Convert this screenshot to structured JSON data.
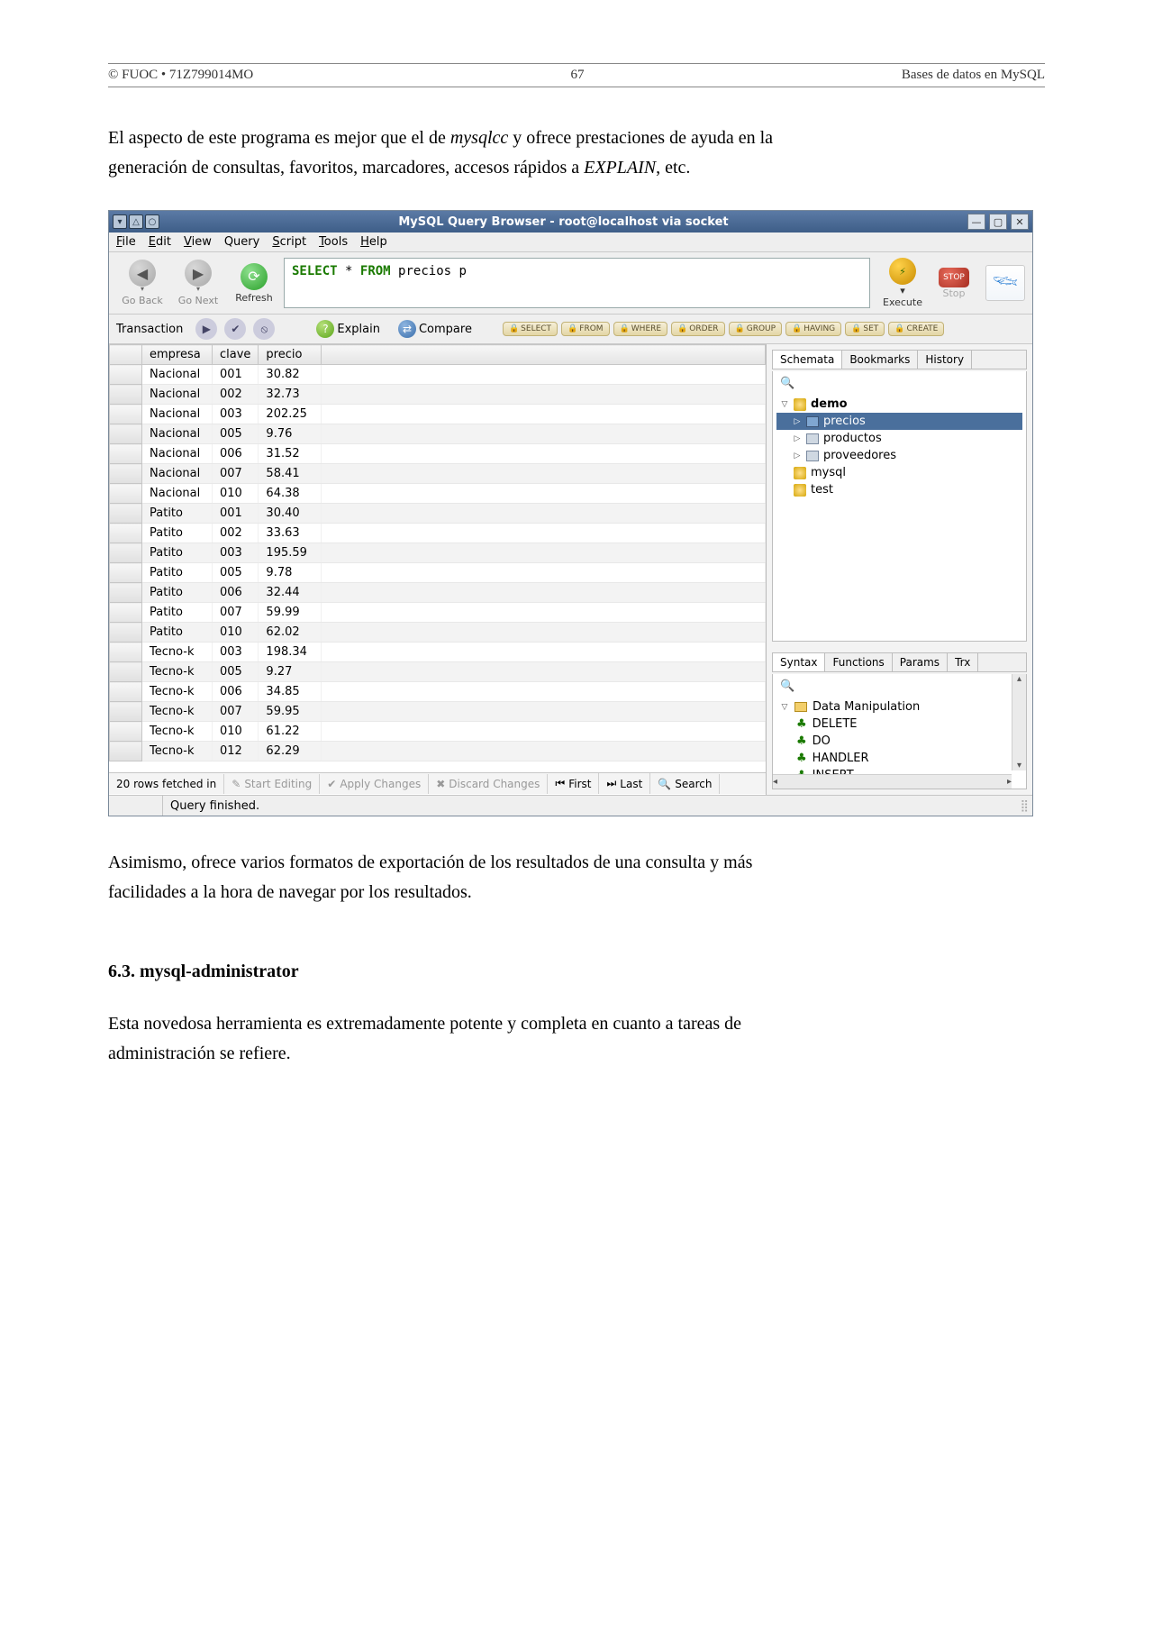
{
  "doc": {
    "header_left": "© FUOC • 71Z799014MO",
    "page_number": "67",
    "header_right": "Bases de datos en MySQL",
    "para1_a": "El aspecto de este programa es mejor que el de ",
    "para1_em1": "mysqlcc",
    "para1_b": " y ofrece prestaciones de ayuda en la generación de consultas, favoritos, marcadores, accesos rápidos a ",
    "para1_em2": "EXPLAIN",
    "para1_c": ", etc.",
    "para2": "Asimismo, ofrece varios formatos de exportación de los resultados de una consulta y más facilidades a la hora de navegar por los resultados.",
    "section": "6.3.   mysql-administrator",
    "para3": "Esta novedosa herramienta es extremadamente potente y completa en cuanto a tareas de administración se refiere."
  },
  "app": {
    "title": "MySQL Query Browser - root@localhost via socket",
    "menu": [
      "File",
      "Edit",
      "View",
      "Query",
      "Script",
      "Tools",
      "Help"
    ],
    "nav": {
      "back": "Go Back",
      "next": "Go Next",
      "refresh": "Refresh"
    },
    "query": {
      "kw1": "SELECT",
      "star": "*",
      "kw2": "FROM",
      "rest": "precios p"
    },
    "exec": {
      "execute": "Execute",
      "stop": "Stop",
      "stoptxt": "STOP"
    },
    "transaction_label": "Transaction",
    "explain": "Explain",
    "compare": "Compare",
    "sqlchips": [
      "SELECT",
      "FROM",
      "WHERE",
      "ORDER",
      "GROUP",
      "HAVING",
      "SET",
      "CREATE"
    ],
    "columns": [
      "empresa",
      "clave",
      "precio"
    ],
    "rows": [
      [
        "Nacional",
        "001",
        "30.82"
      ],
      [
        "Nacional",
        "002",
        "32.73"
      ],
      [
        "Nacional",
        "003",
        "202.25"
      ],
      [
        "Nacional",
        "005",
        "9.76"
      ],
      [
        "Nacional",
        "006",
        "31.52"
      ],
      [
        "Nacional",
        "007",
        "58.41"
      ],
      [
        "Nacional",
        "010",
        "64.38"
      ],
      [
        "Patito",
        "001",
        "30.40"
      ],
      [
        "Patito",
        "002",
        "33.63"
      ],
      [
        "Patito",
        "003",
        "195.59"
      ],
      [
        "Patito",
        "005",
        "9.78"
      ],
      [
        "Patito",
        "006",
        "32.44"
      ],
      [
        "Patito",
        "007",
        "59.99"
      ],
      [
        "Patito",
        "010",
        "62.02"
      ],
      [
        "Tecno-k",
        "003",
        "198.34"
      ],
      [
        "Tecno-k",
        "005",
        "9.27"
      ],
      [
        "Tecno-k",
        "006",
        "34.85"
      ],
      [
        "Tecno-k",
        "007",
        "59.95"
      ],
      [
        "Tecno-k",
        "010",
        "61.22"
      ],
      [
        "Tecno-k",
        "012",
        "62.29"
      ]
    ],
    "footer": {
      "fetched": "20 rows fetched in",
      "start_edit": "Start Editing",
      "apply": "Apply Changes",
      "discard": "Discard Changes",
      "first": "First",
      "last": "Last",
      "search": "Search"
    },
    "status": "Query finished.",
    "side": {
      "tabs_top": [
        "Schemata",
        "Bookmarks",
        "History"
      ],
      "schemata": {
        "db": "demo",
        "tables": [
          "precios",
          "productos",
          "proveedores"
        ],
        "other_dbs": [
          "mysql",
          "test"
        ]
      },
      "tabs_bottom": [
        "Syntax",
        "Functions",
        "Params",
        "Trx"
      ],
      "syntax": {
        "group": "Data Manipulation",
        "items": [
          "DELETE",
          "DO",
          "HANDLER",
          "INSERT"
        ]
      }
    }
  }
}
